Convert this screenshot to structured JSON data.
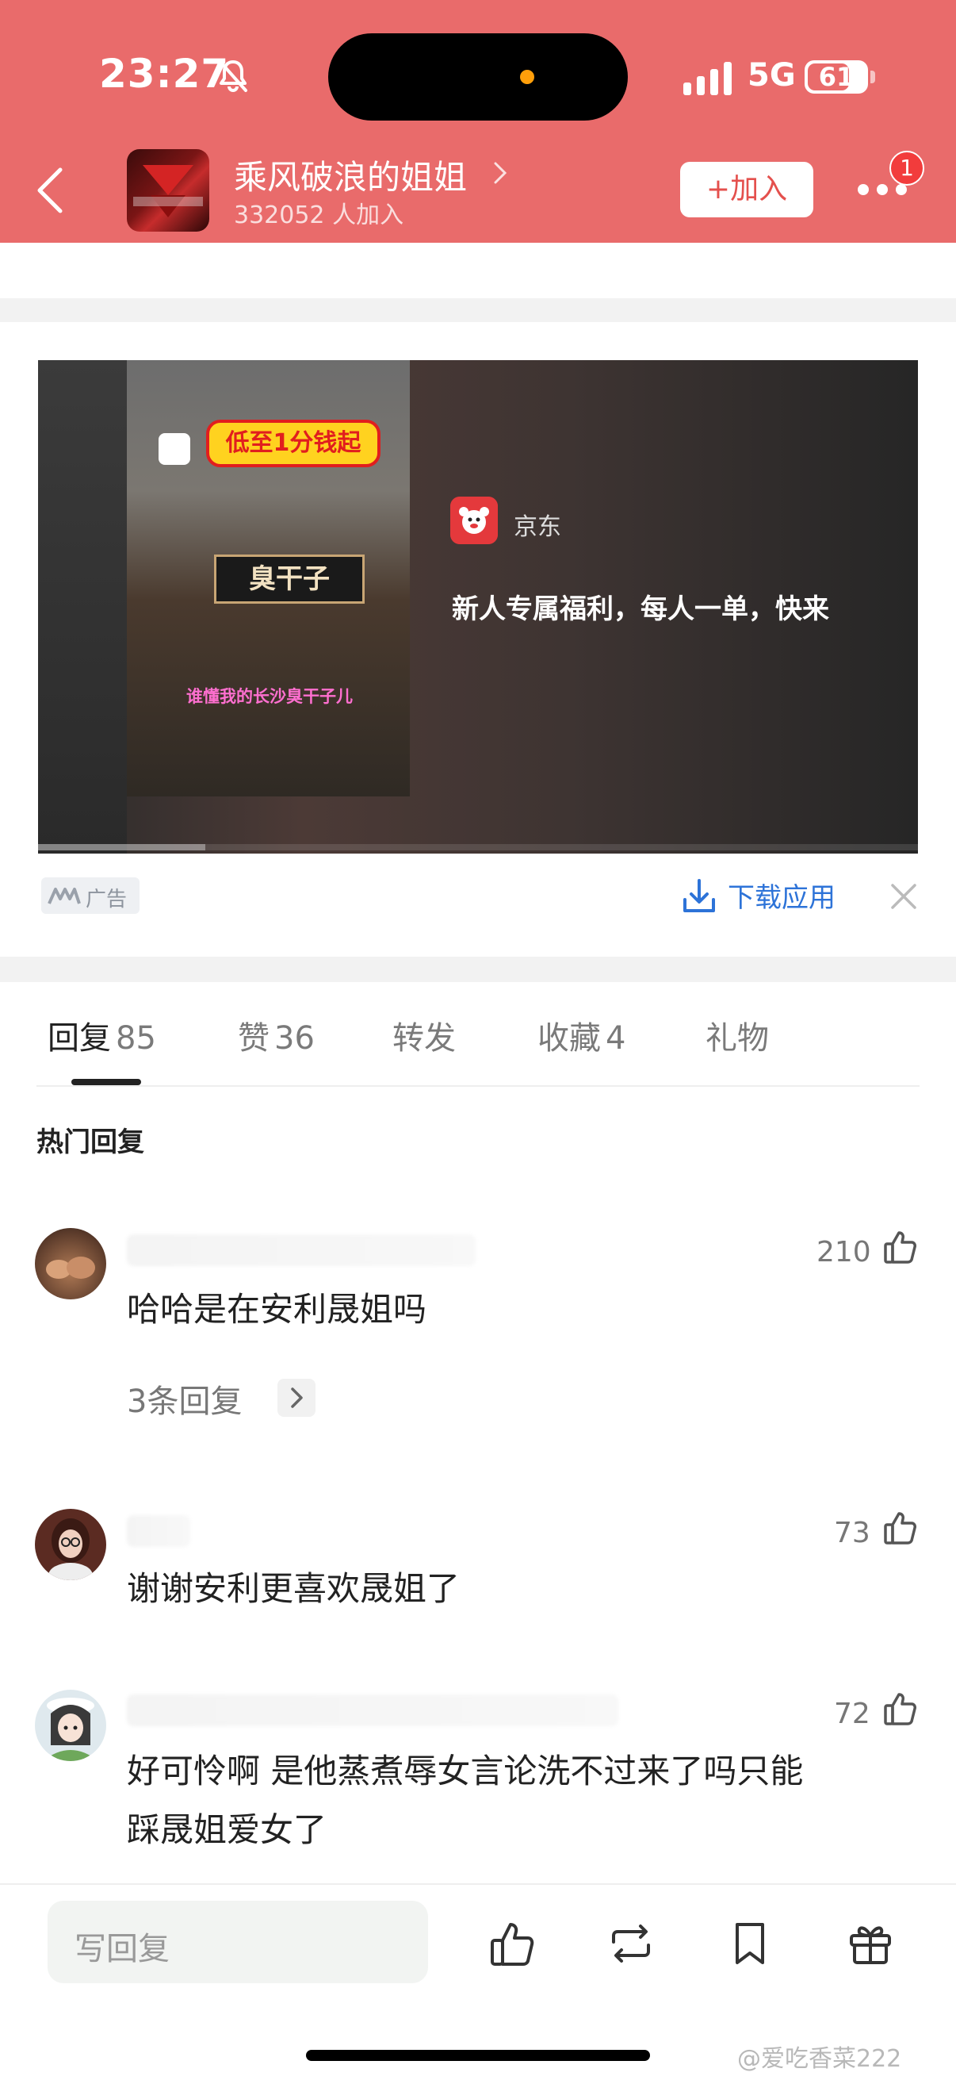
{
  "status_bar": {
    "time": "23:27",
    "network": "5G",
    "battery": "61"
  },
  "header": {
    "group_name": "乘风破浪的姐姐",
    "member_count": "332052",
    "member_suffix": "人加入",
    "join_label": "+加入",
    "notification_badge": "1"
  },
  "ad": {
    "promo_text": "低至1分钱起",
    "sign_text": "臭干子",
    "caption": "谁懂我的长沙臭干子儿",
    "brand": "京东",
    "headline": "新人专属福利，每人一单，快来",
    "tag": "广告",
    "download_label": "下载应用",
    "progress": 0.19
  },
  "tabs": [
    {
      "label": "回复",
      "count": "85",
      "active": true
    },
    {
      "label": "赞",
      "count": "36"
    },
    {
      "label": "转发",
      "count": ""
    },
    {
      "label": "收藏",
      "count": "4"
    },
    {
      "label": "礼物",
      "count": ""
    }
  ],
  "section_title": "热门回复",
  "replies": [
    {
      "likes": "210",
      "text": "哈哈是在安利晟姐吗",
      "sub_replies": "3条回复"
    },
    {
      "likes": "73",
      "text": "谢谢安利更喜欢晟姐了"
    },
    {
      "likes": "72",
      "text_line1": "好可怜啊 是他蒸煮辱女言论洗不过来了吗只能",
      "text_line2": "踩晟姐爱女了"
    }
  ],
  "bottom_bar": {
    "reply_placeholder": "写回复"
  },
  "watermark": "@爱吃香菜222",
  "colors": {
    "header_bg": "#e96b6b",
    "link_blue": "#2d73d8",
    "badge_red": "#f23c3c"
  }
}
